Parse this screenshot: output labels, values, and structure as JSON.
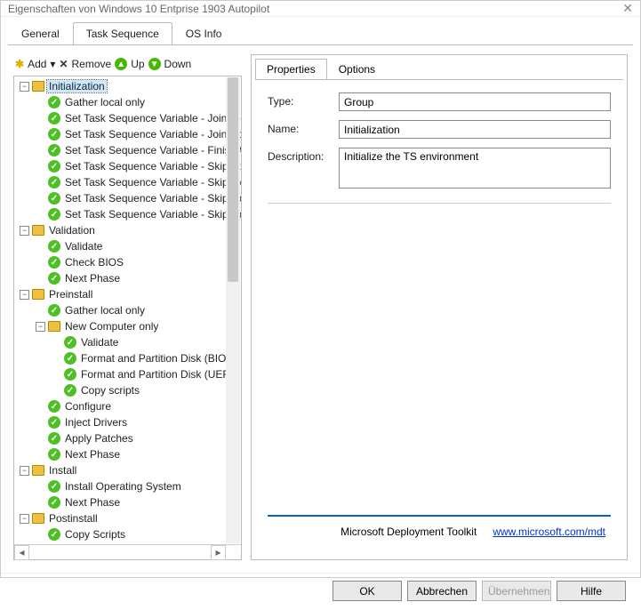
{
  "window": {
    "title": "Eigenschaften von Windows 10 Entprise 1903 Autopilot"
  },
  "main_tabs": [
    {
      "label": "General"
    },
    {
      "label": "Task Sequence"
    },
    {
      "label": "OS Info"
    }
  ],
  "toolbar": {
    "add": "Add",
    "remove": "Remove",
    "up": "Up",
    "down": "Down"
  },
  "tree": [
    {
      "depth": 0,
      "kind": "folder",
      "exp": "minus",
      "label": "Initialization",
      "selected": true
    },
    {
      "depth": 1,
      "kind": "step",
      "label": "Gather local only"
    },
    {
      "depth": 1,
      "kind": "step",
      "label": "Set Task Sequence Variable - JoinDomain"
    },
    {
      "depth": 1,
      "kind": "step",
      "label": "Set Task Sequence Variable - JoinWorkgroup"
    },
    {
      "depth": 1,
      "kind": "step",
      "label": "Set Task Sequence Variable - FinishAction"
    },
    {
      "depth": 1,
      "kind": "step",
      "label": "Set Task Sequence Variable - SkipBitLocker"
    },
    {
      "depth": 1,
      "kind": "step",
      "label": "Set Task Sequence Variable - SkipApplications"
    },
    {
      "depth": 1,
      "kind": "step",
      "label": "Set Task Sequence Variable - SkipComputerBackup"
    },
    {
      "depth": 1,
      "kind": "step",
      "label": "Set Task Sequence Variable - SkipDomainMembership"
    },
    {
      "depth": 0,
      "kind": "folder",
      "exp": "minus",
      "label": "Validation"
    },
    {
      "depth": 1,
      "kind": "step",
      "label": "Validate"
    },
    {
      "depth": 1,
      "kind": "step",
      "label": "Check BIOS"
    },
    {
      "depth": 1,
      "kind": "step",
      "label": "Next Phase"
    },
    {
      "depth": 0,
      "kind": "folder",
      "exp": "minus",
      "label": "Preinstall"
    },
    {
      "depth": 1,
      "kind": "step",
      "label": "Gather local only"
    },
    {
      "depth": 1,
      "kind": "folder",
      "exp": "minus",
      "label": "New Computer only"
    },
    {
      "depth": 2,
      "kind": "step",
      "label": "Validate"
    },
    {
      "depth": 2,
      "kind": "step",
      "label": "Format and Partition Disk (BIOS)"
    },
    {
      "depth": 2,
      "kind": "step",
      "label": "Format and Partition Disk (UEFI)"
    },
    {
      "depth": 2,
      "kind": "step",
      "label": "Copy scripts"
    },
    {
      "depth": 1,
      "kind": "step",
      "label": "Configure"
    },
    {
      "depth": 1,
      "kind": "step",
      "label": "Inject Drivers"
    },
    {
      "depth": 1,
      "kind": "step",
      "label": "Apply Patches"
    },
    {
      "depth": 1,
      "kind": "step",
      "label": "Next Phase"
    },
    {
      "depth": 0,
      "kind": "folder",
      "exp": "minus",
      "label": "Install"
    },
    {
      "depth": 1,
      "kind": "step",
      "label": "Install Operating System"
    },
    {
      "depth": 1,
      "kind": "step",
      "label": "Next Phase"
    },
    {
      "depth": 0,
      "kind": "folder",
      "exp": "minus",
      "label": "Postinstall"
    },
    {
      "depth": 1,
      "kind": "step",
      "label": "Copy Scripts"
    }
  ],
  "sub_tabs": [
    {
      "label": "Properties"
    },
    {
      "label": "Options"
    }
  ],
  "form": {
    "type_label": "Type:",
    "type_value": "Group",
    "name_label": "Name:",
    "name_value": "Initialization",
    "desc_label": "Description:",
    "desc_value": "Initialize the TS environment"
  },
  "footer": {
    "brand": "Microsoft Deployment Toolkit",
    "link_text": "www.microsoft.com/mdt"
  },
  "buttons": {
    "ok": "OK",
    "cancel": "Abbrechen",
    "apply": "Übernehmen",
    "help": "Hilfe"
  }
}
